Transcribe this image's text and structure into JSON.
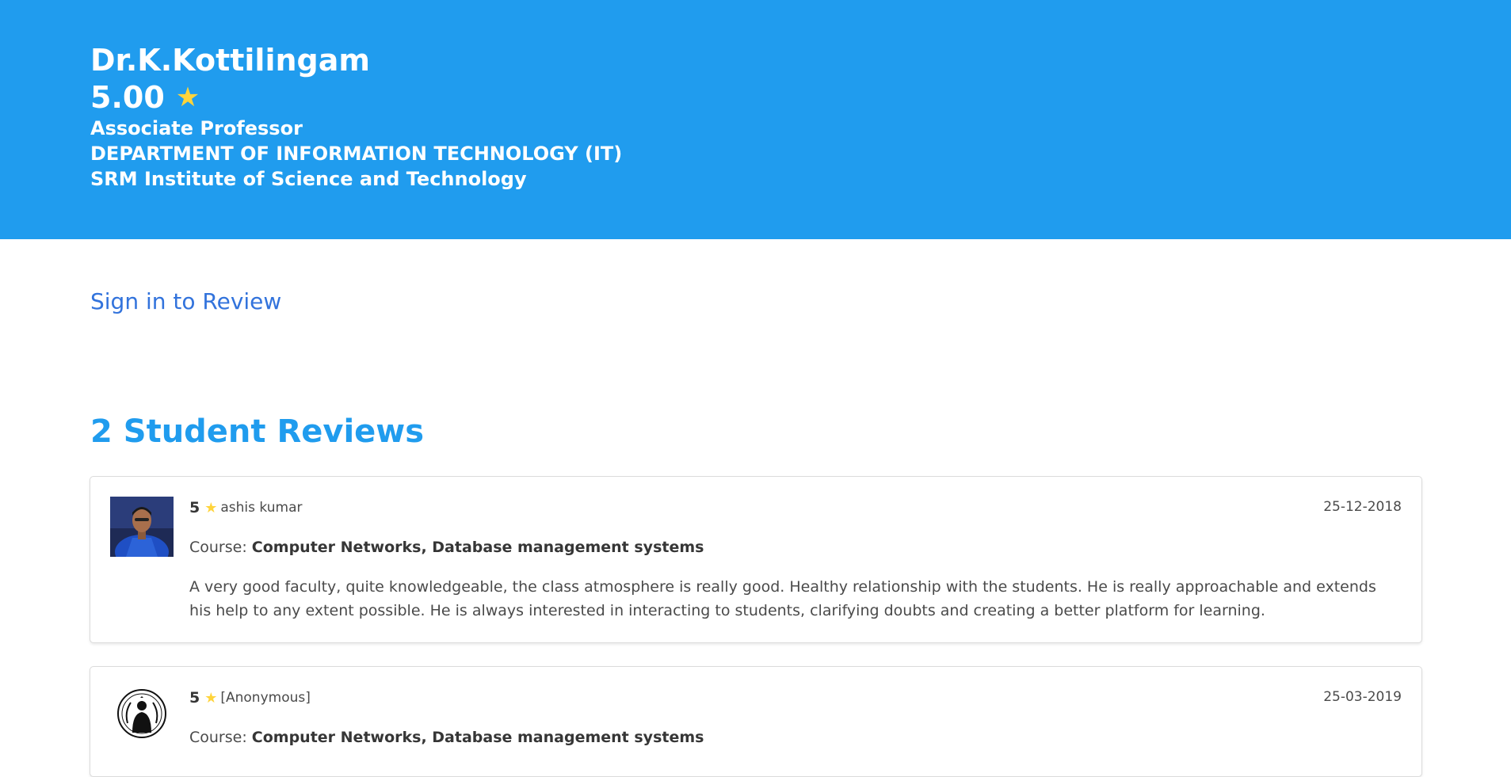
{
  "hero": {
    "name": "Dr.K.Kottilingam",
    "rating": "5.00",
    "star_icon": "star-icon",
    "designation": "Associate Professor",
    "department": "DEPARTMENT OF INFORMATION TECHNOLOGY (IT)",
    "institution": "SRM Institute of Science and Technology",
    "background_color": "#209cee"
  },
  "signin": {
    "label": "Sign in to Review",
    "color": "#3273dc"
  },
  "reviews_section": {
    "title": "2 Student Reviews",
    "color": "#209cee"
  },
  "reviews": [
    {
      "score": "5",
      "user": "ashis kumar",
      "date": "25-12-2018",
      "course_label": "Course:",
      "course": "Computer Networks, Database management systems",
      "text": "A very good faculty, quite knowledgeable, the class atmosphere is really good. Healthy relationship with the students. He is really approachable and extends his help to any extent possible. He is always interested in interacting to students, clarifying doubts and creating a better platform for learning."
    },
    {
      "score": "5",
      "user": "[Anonymous]",
      "date": "25-03-2019",
      "course_label": "Course:",
      "course": "Computer Networks, Database management systems"
    }
  ]
}
